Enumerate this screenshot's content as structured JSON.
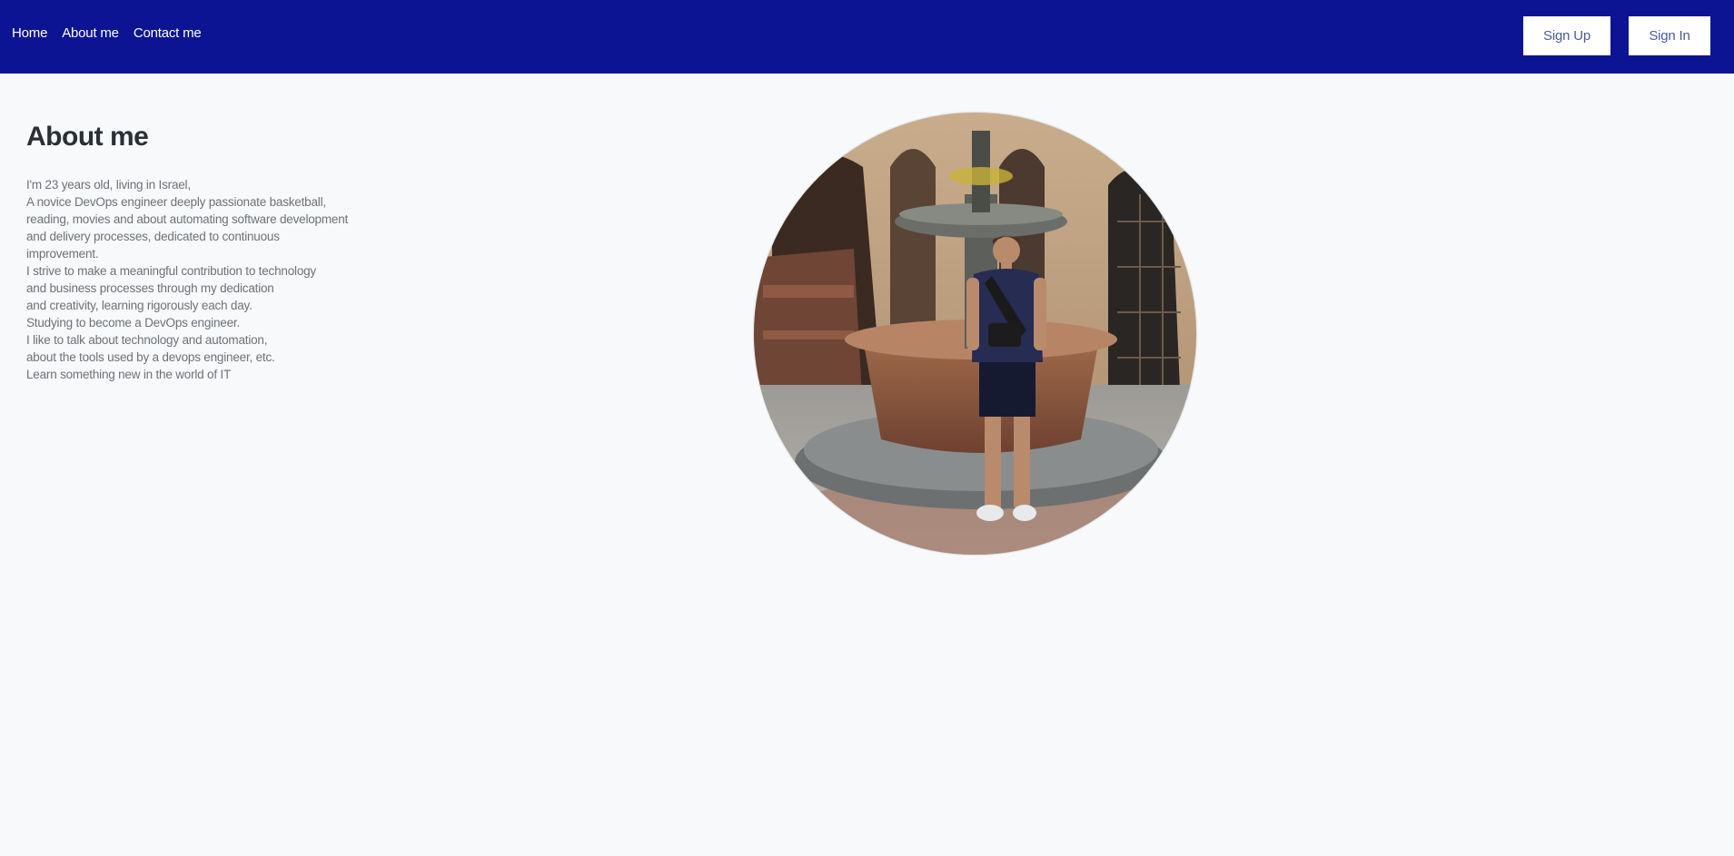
{
  "nav": {
    "links": [
      "Home",
      "About me",
      "Contact me"
    ],
    "sign_up": "Sign Up",
    "sign_in": "Sign In"
  },
  "about": {
    "title": "About me",
    "lines": [
      "I'm 23 years old, living in Israel,",
      "A novice DevOps engineer deeply passionate basketball,",
      "reading, movies and about automating software development",
      "and delivery processes, dedicated to continuous",
      "improvement.",
      "I strive to make a meaningful contribution to technology",
      "and business processes through my dedication",
      "and creativity, learning rigorously each day.",
      "Studying to become a DevOps engineer.",
      "I like to talk about technology and automation,",
      "about the tools used by a devops engineer, etc.",
      "Learn something new in the world of IT"
    ]
  },
  "colors": {
    "navbar": "#0c1494",
    "page_background": "#f7f9fb",
    "title_text": "#2c2f36",
    "body_text": "#6e7177",
    "button_text": "#4a5a9a"
  }
}
